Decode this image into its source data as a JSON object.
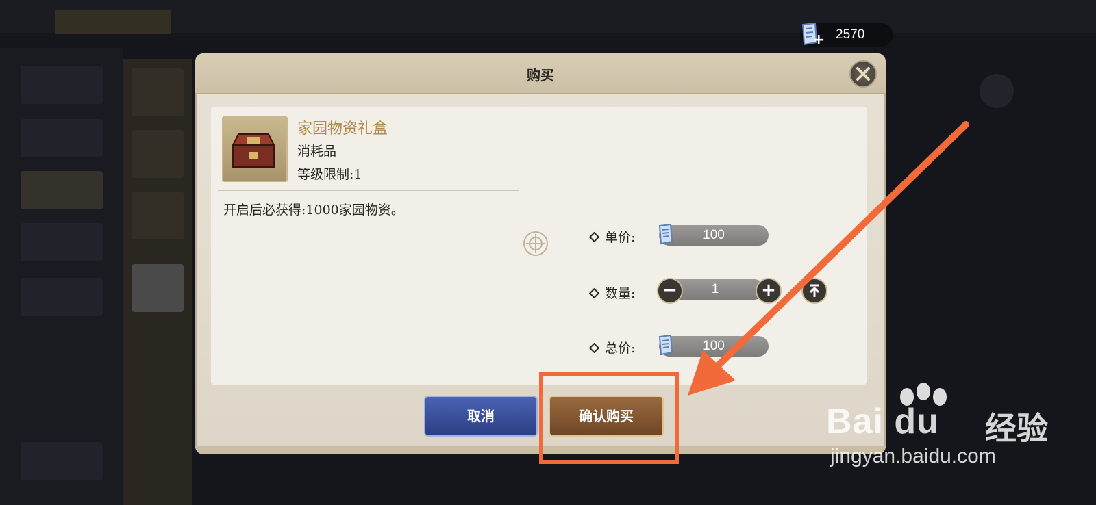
{
  "currency": {
    "amount": "2570",
    "icon": "ticket-icon",
    "add_icon": "plus-icon"
  },
  "dialog": {
    "title": "购买",
    "close_icon": "close-icon"
  },
  "item": {
    "name": "家园物资礼盒",
    "type": "消耗品",
    "level_limit": "等级限制:1",
    "description": "开启后必获得:1000家园物资。"
  },
  "purchase": {
    "unit_price_label": "单价:",
    "unit_price": "100",
    "quantity_label": "数量:",
    "quantity": "1",
    "total_label": "总价:",
    "total": "100"
  },
  "buttons": {
    "cancel": "取消",
    "confirm": "确认购买"
  },
  "watermark": {
    "brand": "Bai du",
    "brand_cn": "经验",
    "site": "jingyan.baidu.com"
  },
  "colors": {
    "annotation": "#f26a3a",
    "item_name": "#b08a4a",
    "cancel_button": "#2c3e84",
    "confirm_button": "#6e4626"
  }
}
